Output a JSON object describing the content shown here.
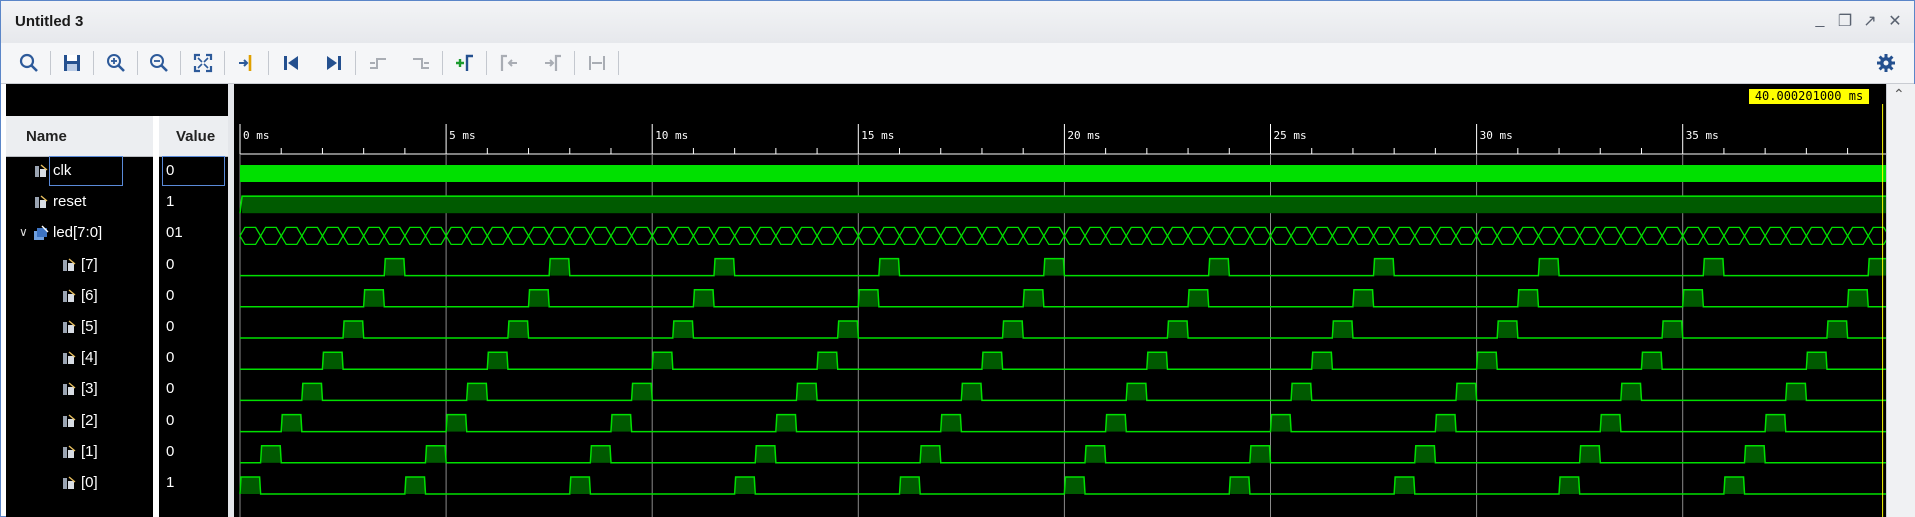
{
  "window": {
    "title": "Untitled 3",
    "controls": [
      "minimize-icon",
      "restore-icon",
      "maximize-icon",
      "close-icon"
    ]
  },
  "toolbar": {
    "tools": [
      {
        "name": "search-icon",
        "enabled": true
      },
      {
        "name": "save-icon",
        "enabled": true
      },
      {
        "name": "zoom-in-icon",
        "enabled": true
      },
      {
        "name": "zoom-out-icon",
        "enabled": true
      },
      {
        "name": "zoom-fit-icon",
        "enabled": true
      },
      {
        "name": "go-to-cursor-icon",
        "enabled": true
      },
      {
        "name": "go-to-time-zero-icon",
        "enabled": true
      },
      {
        "name": "go-to-last-time-icon",
        "enabled": true
      },
      {
        "name": "previous-transition-icon",
        "enabled": false
      },
      {
        "name": "next-transition-icon",
        "enabled": false
      },
      {
        "name": "add-marker-icon",
        "enabled": true
      },
      {
        "name": "previous-marker-icon",
        "enabled": false
      },
      {
        "name": "next-marker-icon",
        "enabled": false
      },
      {
        "name": "swap-cursors-icon",
        "enabled": false
      }
    ],
    "settings_icon": "gear-icon"
  },
  "columns": {
    "name": "Name",
    "value": "Value"
  },
  "signals": [
    {
      "name": "clk",
      "value": "0",
      "kind": "bit",
      "selected": true
    },
    {
      "name": "reset",
      "value": "1",
      "kind": "bit"
    },
    {
      "name": "led[7:0]",
      "value": "01",
      "kind": "bus",
      "expanded": true
    },
    {
      "name": "[7]",
      "value": "0",
      "kind": "bit",
      "child": true
    },
    {
      "name": "[6]",
      "value": "0",
      "kind": "bit",
      "child": true
    },
    {
      "name": "[5]",
      "value": "0",
      "kind": "bit",
      "child": true
    },
    {
      "name": "[4]",
      "value": "0",
      "kind": "bit",
      "child": true
    },
    {
      "name": "[3]",
      "value": "0",
      "kind": "bit",
      "child": true
    },
    {
      "name": "[2]",
      "value": "0",
      "kind": "bit",
      "child": true
    },
    {
      "name": "[1]",
      "value": "0",
      "kind": "bit",
      "child": true
    },
    {
      "name": "[0]",
      "value": "1",
      "kind": "bit",
      "child": true
    }
  ],
  "timeline": {
    "tick_labels": [
      "0 ms",
      "5 ms",
      "10 ms",
      "15 ms",
      "20 ms",
      "25 ms",
      "30 ms",
      "35 ms"
    ],
    "cursor_label": "40.000201000 ms"
  },
  "colors": {
    "wave": "#00e000",
    "wave_fill": "#005a00",
    "clock_fill": "#00e000",
    "grid": "#8a8a8a",
    "cursor_label_bg": "#ffff00"
  }
}
